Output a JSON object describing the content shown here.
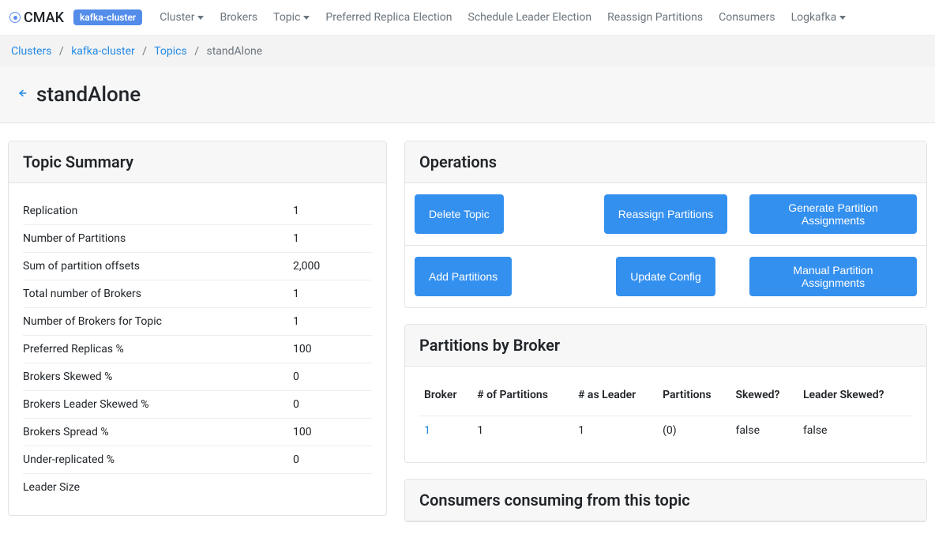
{
  "navbar": {
    "brand": "CMAK",
    "cluster_badge": "kafka-cluster",
    "items": [
      {
        "label": "Cluster",
        "dropdown": true
      },
      {
        "label": "Brokers",
        "dropdown": false
      },
      {
        "label": "Topic",
        "dropdown": true
      },
      {
        "label": "Preferred Replica Election",
        "dropdown": false
      },
      {
        "label": "Schedule Leader Election",
        "dropdown": false
      },
      {
        "label": "Reassign Partitions",
        "dropdown": false
      },
      {
        "label": "Consumers",
        "dropdown": false
      },
      {
        "label": "Logkafka",
        "dropdown": true
      }
    ]
  },
  "breadcrumb": {
    "items": [
      "Clusters",
      "kafka-cluster",
      "Topics"
    ],
    "current": "standAlone"
  },
  "page_title": "standAlone",
  "summary": {
    "heading": "Topic Summary",
    "rows": [
      {
        "label": "Replication",
        "value": "1"
      },
      {
        "label": "Number of Partitions",
        "value": "1"
      },
      {
        "label": "Sum of partition offsets",
        "value": "2,000"
      },
      {
        "label": "Total number of Brokers",
        "value": "1"
      },
      {
        "label": "Number of Brokers for Topic",
        "value": "1"
      },
      {
        "label": "Preferred Replicas %",
        "value": "100"
      },
      {
        "label": "Brokers Skewed %",
        "value": "0"
      },
      {
        "label": "Brokers Leader Skewed %",
        "value": "0"
      },
      {
        "label": "Brokers Spread %",
        "value": "100"
      },
      {
        "label": "Under-replicated %",
        "value": "0"
      },
      {
        "label": "Leader Size",
        "value": ""
      }
    ]
  },
  "operations": {
    "heading": "Operations",
    "row1": [
      {
        "name": "delete-topic-button",
        "label": "Delete Topic"
      },
      {
        "name": "reassign-partitions-button",
        "label": "Reassign Partitions"
      },
      {
        "name": "generate-partition-assignments-button",
        "label": "Generate Partition Assignments"
      }
    ],
    "row2": [
      {
        "name": "add-partitions-button",
        "label": "Add Partitions"
      },
      {
        "name": "update-config-button",
        "label": "Update Config"
      },
      {
        "name": "manual-partition-assignments-button",
        "label": "Manual Partition Assignments"
      }
    ]
  },
  "partitions_by_broker": {
    "heading": "Partitions by Broker",
    "columns": [
      "Broker",
      "# of Partitions",
      "# as Leader",
      "Partitions",
      "Skewed?",
      "Leader Skewed?"
    ],
    "rows": [
      {
        "broker": "1",
        "num_partitions": "1",
        "num_leader": "1",
        "partitions": "(0)",
        "skewed": "false",
        "leader_skewed": "false"
      }
    ]
  },
  "consumers": {
    "heading": "Consumers consuming from this topic"
  }
}
